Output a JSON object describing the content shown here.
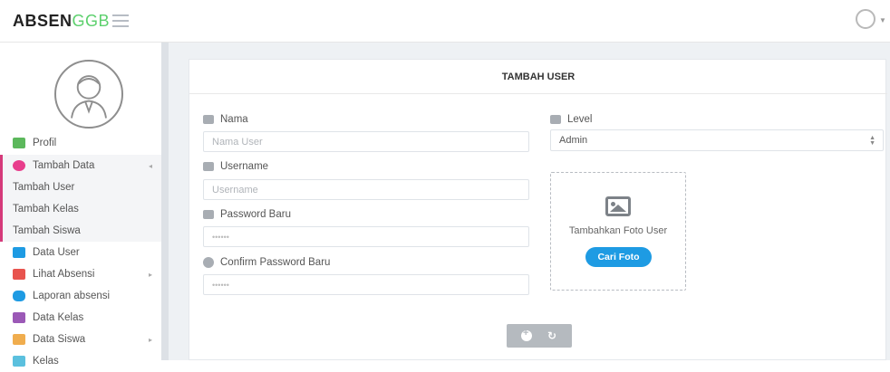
{
  "header": {
    "brand_primary": "ABSEN",
    "brand_accent": "GGB",
    "menu_icon": "hamburger-icon",
    "user_icon": "user-avatar-icon"
  },
  "sidebar": {
    "items": [
      {
        "label": "Profil",
        "icon": "user-icon",
        "color": "#5cb85c"
      },
      {
        "label": "Tambah Data",
        "icon": "plus-circle-icon",
        "color": "#e83e8c",
        "active": true
      },
      {
        "label": "Data User",
        "icon": "id-card-icon",
        "color": "#1e9be3"
      },
      {
        "label": "Lihat Absensi",
        "icon": "list-icon",
        "color": "#e8544e"
      },
      {
        "label": "Laporan absensi",
        "icon": "database-icon",
        "color": "#1e9be3"
      },
      {
        "label": "Data Kelas",
        "icon": "graduation-cap-icon",
        "color": "#9b59b6"
      },
      {
        "label": "Data Siswa",
        "icon": "users-icon",
        "color": "#f0ad4e"
      },
      {
        "label": "Kelas",
        "icon": "book-icon",
        "color": "#5bc0de"
      }
    ],
    "submenu": [
      {
        "label": "Tambah User"
      },
      {
        "label": "Tambah Kelas"
      },
      {
        "label": "Tambah Siswa"
      }
    ]
  },
  "panel": {
    "title": "TAMBAH USER",
    "fields": {
      "nama_label": "Nama",
      "nama_placeholder": "Nama User",
      "username_label": "Username",
      "username_placeholder": "Username",
      "password_label": "Password Baru",
      "password_value": "••••••",
      "confirm_label": "Confirm Password Baru",
      "confirm_value": "••••••",
      "level_label": "Level",
      "level_value": "Admin"
    },
    "photo": {
      "caption": "Tambahkan Foto User",
      "button": "Cari Foto"
    }
  },
  "colors": {
    "accent": "#5cd06d",
    "primary_button": "#1e9be3",
    "active_border": "#d53a7a"
  }
}
